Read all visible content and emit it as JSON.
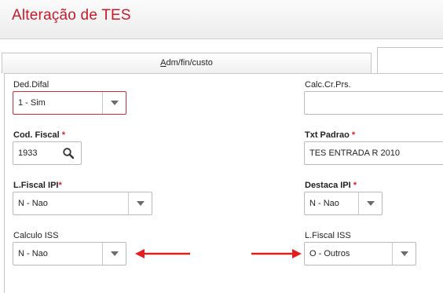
{
  "page": {
    "title": "Alteração de TES"
  },
  "tabs": [
    {
      "label_prefix": "",
      "label_underlined": "A",
      "label_rest": "dm/fin/custo"
    },
    {
      "label": ""
    }
  ],
  "fields": {
    "ded_difal": {
      "label": "Ded.Difal",
      "value": "1 - Sim"
    },
    "calc_cr_prs": {
      "label": "Calc.Cr.Prs.",
      "value": ""
    },
    "cod_fiscal": {
      "label": "Cod. Fiscal",
      "required_mark": "*",
      "value": "1933"
    },
    "txt_padrao": {
      "label": "Txt Padrao",
      "required_mark": "*",
      "value": "TES ENTRADA R 2010"
    },
    "l_fiscal_ipi": {
      "label": "L.Fiscal IPI",
      "required_mark": "*",
      "value": "N - Nao"
    },
    "destaca_ipi": {
      "label": "Destaca IPI",
      "required_mark": "*",
      "value": "N - Nao"
    },
    "calculo_iss": {
      "label": "Calculo ISS",
      "value": "N - Nao"
    },
    "l_fiscal_iss": {
      "label": "L.Fiscal ISS",
      "value": "O - Outros"
    }
  },
  "colors": {
    "title": "#c81a2b",
    "required": "#d0202e",
    "annotation_arrow": "#e02020",
    "focus_border": "#c0303d"
  },
  "icons": {
    "lookup": "search-icon",
    "dropdown": "chevron-down-icon",
    "annotation": "arrow-icon"
  }
}
